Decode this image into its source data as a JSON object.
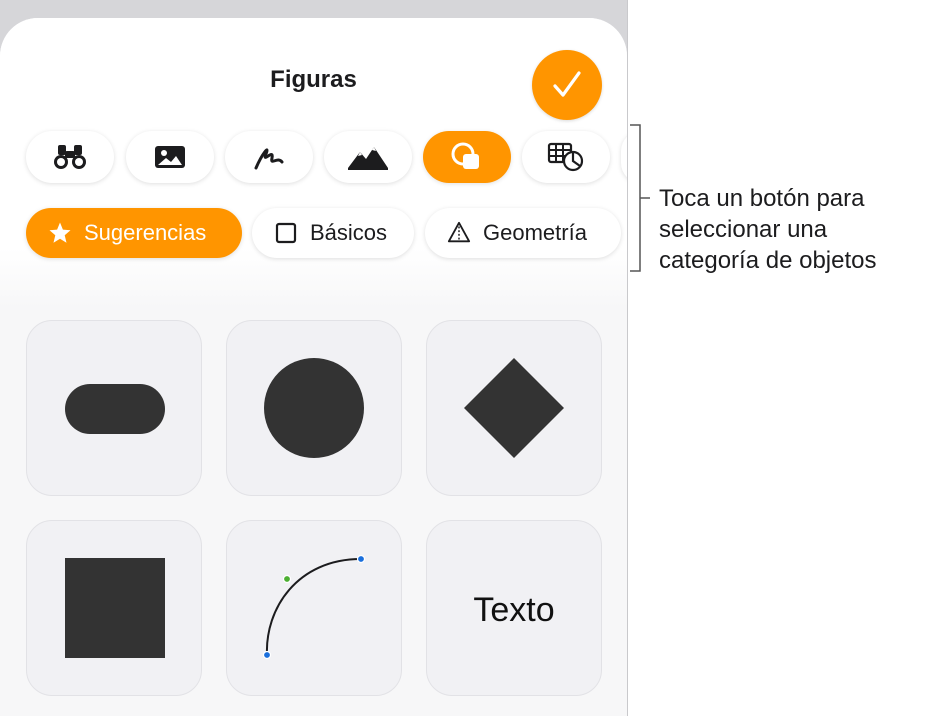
{
  "sheet": {
    "title": "Figuras",
    "done_icon": "checkmark-icon"
  },
  "categories": [
    {
      "icon": "binoculars-icon",
      "active": false
    },
    {
      "icon": "photo-icon",
      "active": false
    },
    {
      "icon": "drawing-icon",
      "active": false
    },
    {
      "icon": "mountains-icon",
      "active": false
    },
    {
      "icon": "shapes-icon",
      "active": true
    },
    {
      "icon": "table-chart-icon",
      "active": false
    }
  ],
  "subcategories": [
    {
      "label": "Sugerencias",
      "icon": "star-icon",
      "active": true
    },
    {
      "label": "Básicos",
      "icon": "square-outline-icon",
      "active": false
    },
    {
      "label": "Geometría",
      "icon": "pyramid-icon",
      "active": false
    }
  ],
  "shapes": [
    {
      "name": "rounded-rectangle",
      "icon": "capsule-shape-icon"
    },
    {
      "name": "circle",
      "icon": "circle-shape-icon"
    },
    {
      "name": "diamond",
      "icon": "diamond-shape-icon"
    },
    {
      "name": "square",
      "icon": "square-shape-icon"
    },
    {
      "name": "curve",
      "icon": "curve-line-icon"
    },
    {
      "name": "text",
      "label": "Texto"
    }
  ],
  "colors": {
    "accent": "#ff9500",
    "shape_fill": "#333333",
    "handle_blue": "#1a6fdc",
    "handle_green": "#4caf32"
  },
  "callout": {
    "lines": [
      "Toca un botón para",
      "seleccionar una",
      "categoría de objetos"
    ]
  }
}
